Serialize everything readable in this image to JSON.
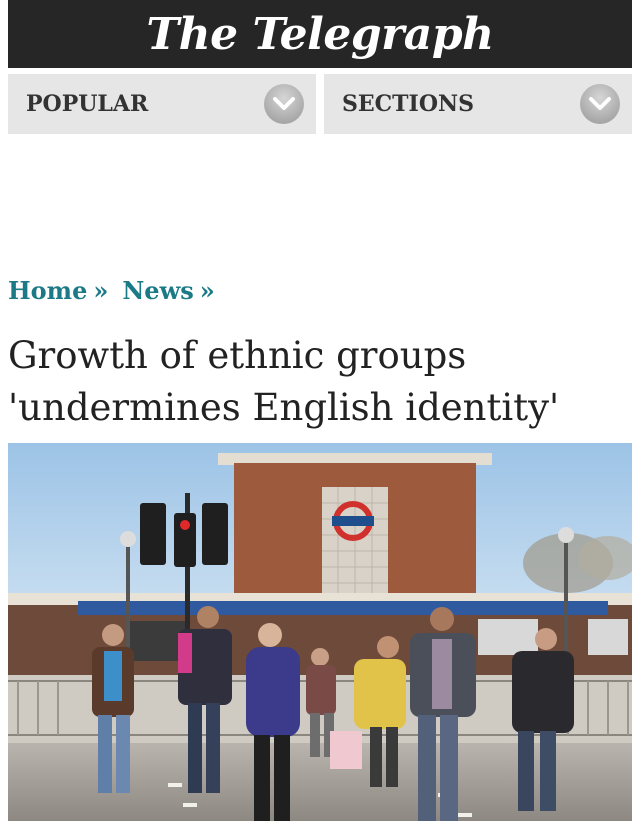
{
  "masthead": {
    "title": "The Telegraph"
  },
  "nav": {
    "popular_label": "POPULAR",
    "sections_label": "SECTIONS"
  },
  "breadcrumb": {
    "items": [
      {
        "label": "Home",
        "separator": "»"
      },
      {
        "label": "News",
        "separator": "»"
      }
    ]
  },
  "article": {
    "headline_line1": "Growth of ethnic groups",
    "headline_line2": "'undermines English identity'"
  },
  "colors": {
    "masthead_bg": "#262626",
    "nav_bg": "#e6e6e6",
    "link": "#1b7a86",
    "headline": "#222222"
  },
  "icons": {
    "nav_toggle": "chevron-down-icon",
    "station_sign": "underground-roundel"
  }
}
